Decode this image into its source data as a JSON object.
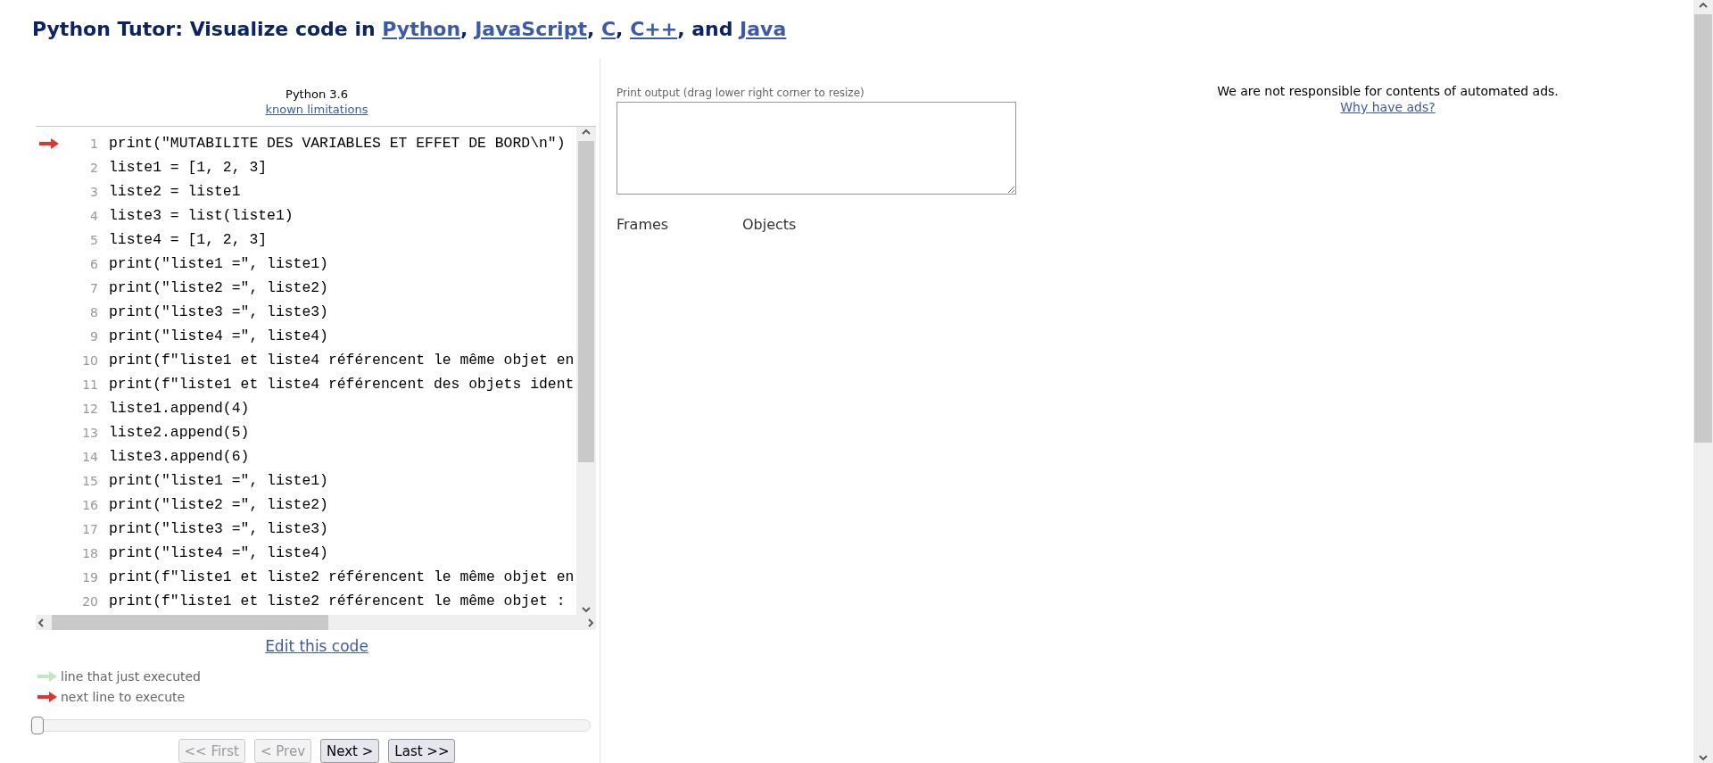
{
  "header": {
    "title": [
      {
        "kind": "text",
        "text": "Python Tutor: Visualize code in "
      },
      {
        "kind": "link",
        "text": "Python"
      },
      {
        "kind": "text",
        "text": ", "
      },
      {
        "kind": "link",
        "text": "JavaScript"
      },
      {
        "kind": "text",
        "text": ", "
      },
      {
        "kind": "link",
        "text": "C"
      },
      {
        "kind": "text",
        "text": ", "
      },
      {
        "kind": "link",
        "text": "C++"
      },
      {
        "kind": "text",
        "text": ", and "
      },
      {
        "kind": "link",
        "text": "Java"
      }
    ]
  },
  "editor": {
    "language": "Python 3.6",
    "limitations_link": "known limitations",
    "lines": [
      {
        "number": "1",
        "code": "print(\"MUTABILITE DES VARIABLES ET EFFET DE BORD\\n\")",
        "next_to_execute": true
      },
      {
        "number": "2",
        "code": "liste1 = [1, 2, 3]",
        "next_to_execute": false
      },
      {
        "number": "3",
        "code": "liste2 = liste1",
        "next_to_execute": false
      },
      {
        "number": "4",
        "code": "liste3 = list(liste1)",
        "next_to_execute": false
      },
      {
        "number": "5",
        "code": "liste4 = [1, 2, 3]",
        "next_to_execute": false
      },
      {
        "number": "6",
        "code": "print(\"liste1 =\", liste1)",
        "next_to_execute": false
      },
      {
        "number": "7",
        "code": "print(\"liste2 =\", liste2)",
        "next_to_execute": false
      },
      {
        "number": "8",
        "code": "print(\"liste3 =\", liste3)",
        "next_to_execute": false
      },
      {
        "number": "9",
        "code": "print(\"liste4 =\", liste4)",
        "next_to_execute": false
      },
      {
        "number": "10",
        "code": "print(f\"liste1 et liste4 référencent le même objet en",
        "next_to_execute": false
      },
      {
        "number": "11",
        "code": "print(f\"liste1 et liste4 référencent des objets ident",
        "next_to_execute": false
      },
      {
        "number": "12",
        "code": "liste1.append(4)",
        "next_to_execute": false
      },
      {
        "number": "13",
        "code": "liste2.append(5)",
        "next_to_execute": false
      },
      {
        "number": "14",
        "code": "liste3.append(6)",
        "next_to_execute": false
      },
      {
        "number": "15",
        "code": "print(\"liste1 =\", liste1)",
        "next_to_execute": false
      },
      {
        "number": "16",
        "code": "print(\"liste2 =\", liste2)",
        "next_to_execute": false
      },
      {
        "number": "17",
        "code": "print(\"liste3 =\", liste3)",
        "next_to_execute": false
      },
      {
        "number": "18",
        "code": "print(\"liste4 =\", liste4)",
        "next_to_execute": false
      },
      {
        "number": "19",
        "code": "print(f\"liste1 et liste2 référencent le même objet en",
        "next_to_execute": false
      },
      {
        "number": "20",
        "code": "print(f\"liste1 et liste2 référencent le même objet :",
        "next_to_execute": false
      }
    ]
  },
  "edit_link": "Edit this code",
  "legend": [
    {
      "kind": "just_executed",
      "text": "line that just executed"
    },
    {
      "kind": "next",
      "text": "next line to execute"
    }
  ],
  "step_slider": {
    "level": 0
  },
  "nav_buttons": [
    {
      "label": "<< First",
      "disabled": true
    },
    {
      "label": "< Prev",
      "disabled": true
    },
    {
      "label": "Next >",
      "disabled": false
    },
    {
      "label": "Last >>",
      "disabled": false
    }
  ],
  "output": {
    "label": "Print output (drag lower right corner to resize)",
    "frames_heading": "Frames",
    "objects_heading": "Objects"
  },
  "ad_notice": {
    "text": "We are not responsible for contents of automated ads.",
    "link": "Why have ads?"
  }
}
